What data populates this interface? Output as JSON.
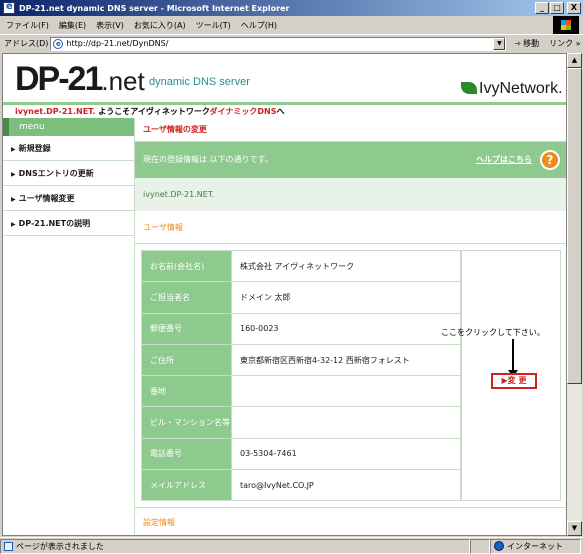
{
  "window": {
    "title": "DP-21.net dynamic DNS server - Microsoft Internet Explorer",
    "min": "_",
    "max": "□",
    "close": "X"
  },
  "menubar": [
    "ファイル(F)",
    "編集(E)",
    "表示(V)",
    "お気に入り(A)",
    "ツール(T)",
    "ヘルプ(H)"
  ],
  "addressbar": {
    "label": "アドレス(D)",
    "url": "http://dp-21.net/DynDNS/",
    "go_label": "移動",
    "links_label": "リンク »"
  },
  "header": {
    "logo_main": "DP-21",
    "logo_net": ".net",
    "subtitle": "dynamic DNS server",
    "partner_logo": "IvyNetwork."
  },
  "welcome": {
    "domain": "ivynet.DP-21.NET.",
    "text_before": " ようこそアイヴィネットワーク",
    "text_red": "ダイナミックDNS",
    "text_after": "へ"
  },
  "sidebar": {
    "title": "menu",
    "items": [
      {
        "label": "新規登録"
      },
      {
        "label": "DNSエントリの更新"
      },
      {
        "label": "ユーザ情報変更"
      },
      {
        "label": "DP-21.NETの説明"
      }
    ]
  },
  "main": {
    "section_title": "ユーザ情報の変更",
    "info_text": "現在の登録情報は 以下の通りです。",
    "help_link": "ヘルプはこちら",
    "help_icon": "?",
    "domain": "ivynet.DP-21.NET.",
    "user_info_title": "ユーザ情報",
    "rows": [
      {
        "label": "お名前(会社名)",
        "value": "株式会社 アイヴィネットワーク"
      },
      {
        "label": "ご担当者名",
        "value": "ドメイン 太郎"
      },
      {
        "label": "郵便番号",
        "value": "160-0023"
      },
      {
        "label": "ご住所",
        "value": "東京都新宿区西新宿4-32-12 西新宿フォレスト"
      },
      {
        "label": "番地",
        "value": ""
      },
      {
        "label": "ビル・マンション名等",
        "value": ""
      },
      {
        "label": "電話番号",
        "value": "03-5304-7461"
      },
      {
        "label": "メイルアドレス",
        "value": "taro@IvyNet.CO.JP"
      }
    ],
    "hint": "ここをクリックして下さい。",
    "change_button": "▶変 更",
    "settings_title": "設定情報"
  },
  "status": {
    "text": "ページが表示されました",
    "zone": "インターネット"
  }
}
